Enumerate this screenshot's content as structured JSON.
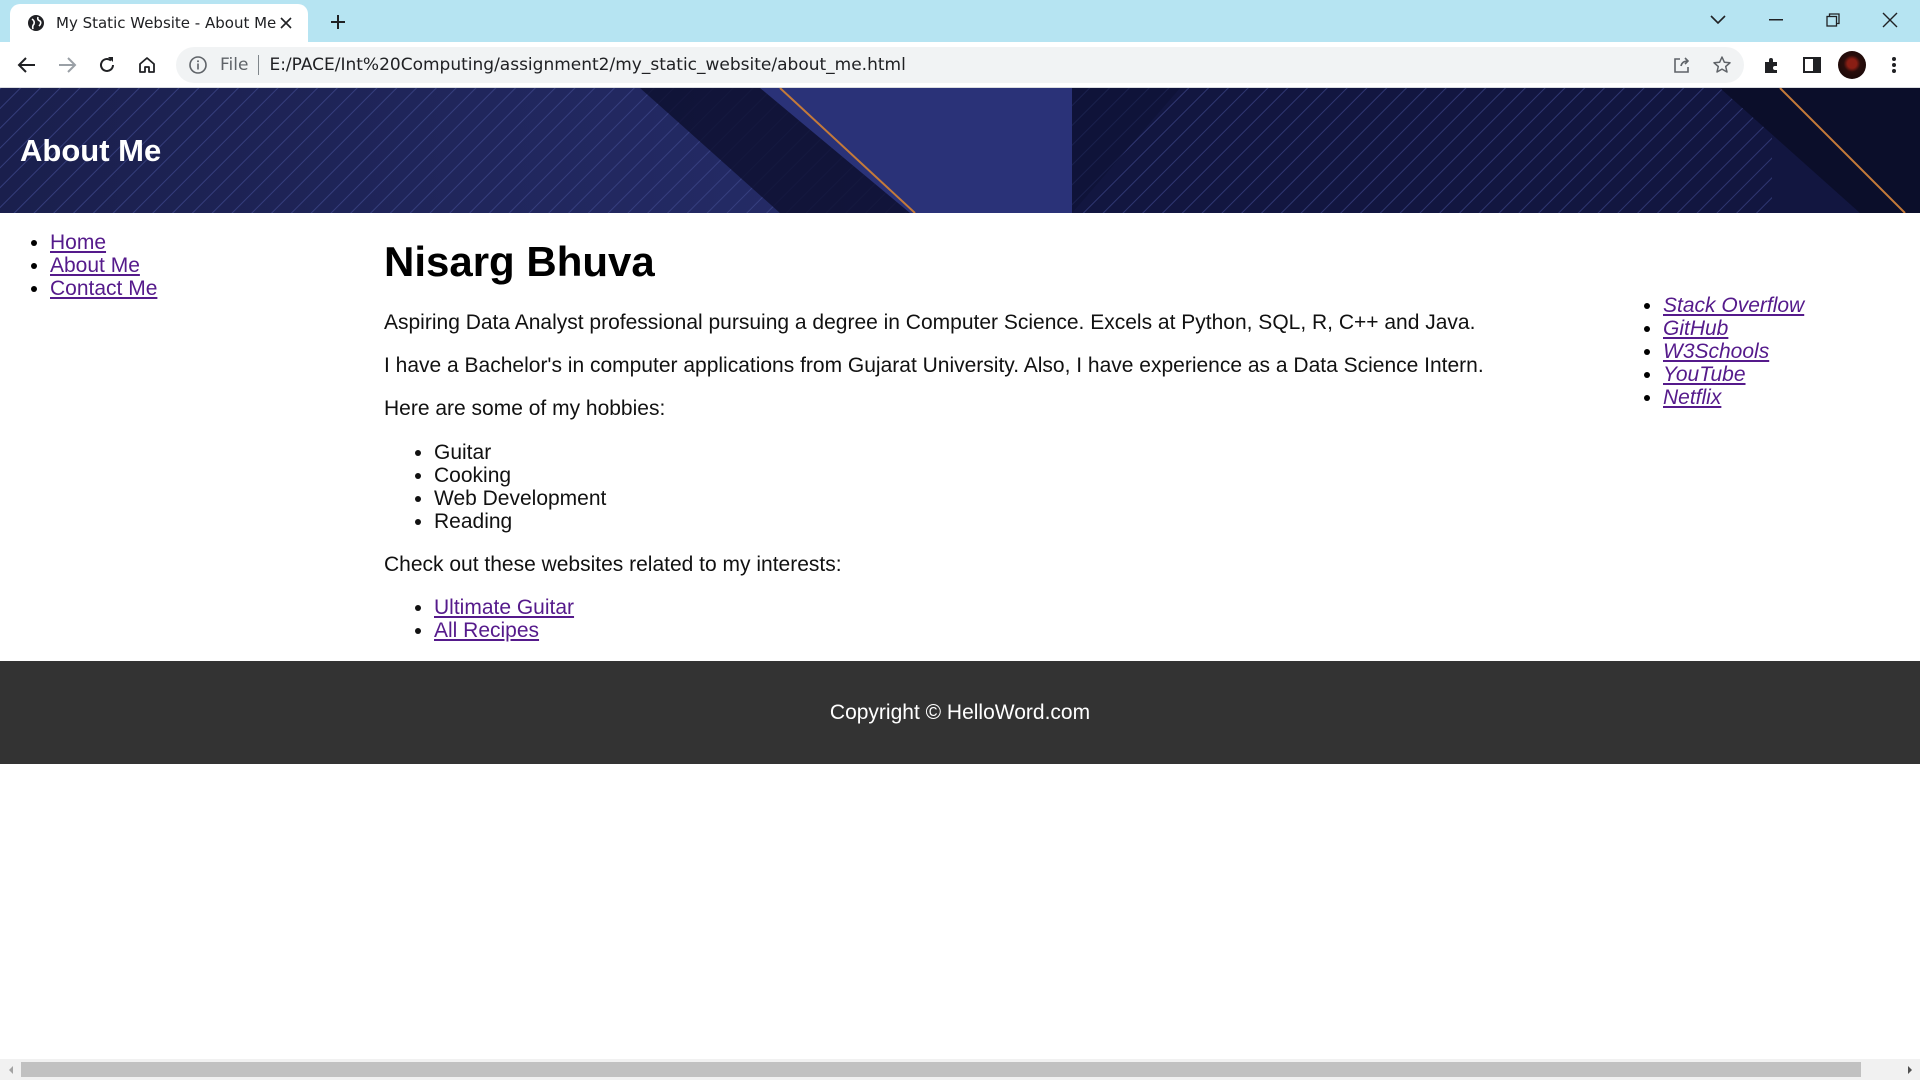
{
  "browser": {
    "tab_title": "My Static Website - About Me",
    "omnibox_label": "File",
    "url": "E:/PACE/Int%20Computing/assignment2/my_static_website/about_me.html"
  },
  "page": {
    "header_title": "About Me",
    "nav": [
      {
        "label": "Home"
      },
      {
        "label": "About Me"
      },
      {
        "label": "Contact Me"
      }
    ],
    "name": "Nisarg Bhuva",
    "para1": "Aspiring Data Analyst professional pursuing a degree in Computer Science. Excels at Python, SQL, R, C++ and Java.",
    "para2": "I have a Bachelor's in computer applications from Gujarat University. Also, I have experience as a Data Science Intern.",
    "hobbies_intro": "Here are some of my hobbies:",
    "hobbies": [
      "Guitar",
      "Cooking",
      "Web Development",
      "Reading"
    ],
    "interests_intro": "Check out these websites related to my interests:",
    "interest_links": [
      "Ultimate Guitar",
      "All Recipes"
    ],
    "side_links": [
      "Stack Overflow",
      "GitHub",
      "W3Schools",
      "YouTube",
      "Netflix"
    ],
    "footer": "Copyright © HelloWord.com"
  },
  "colors": {
    "tabstrip": "#b6e4f2",
    "header_bg": "#151a45",
    "visited_link": "#551a8b",
    "footer_bg": "#333333"
  }
}
